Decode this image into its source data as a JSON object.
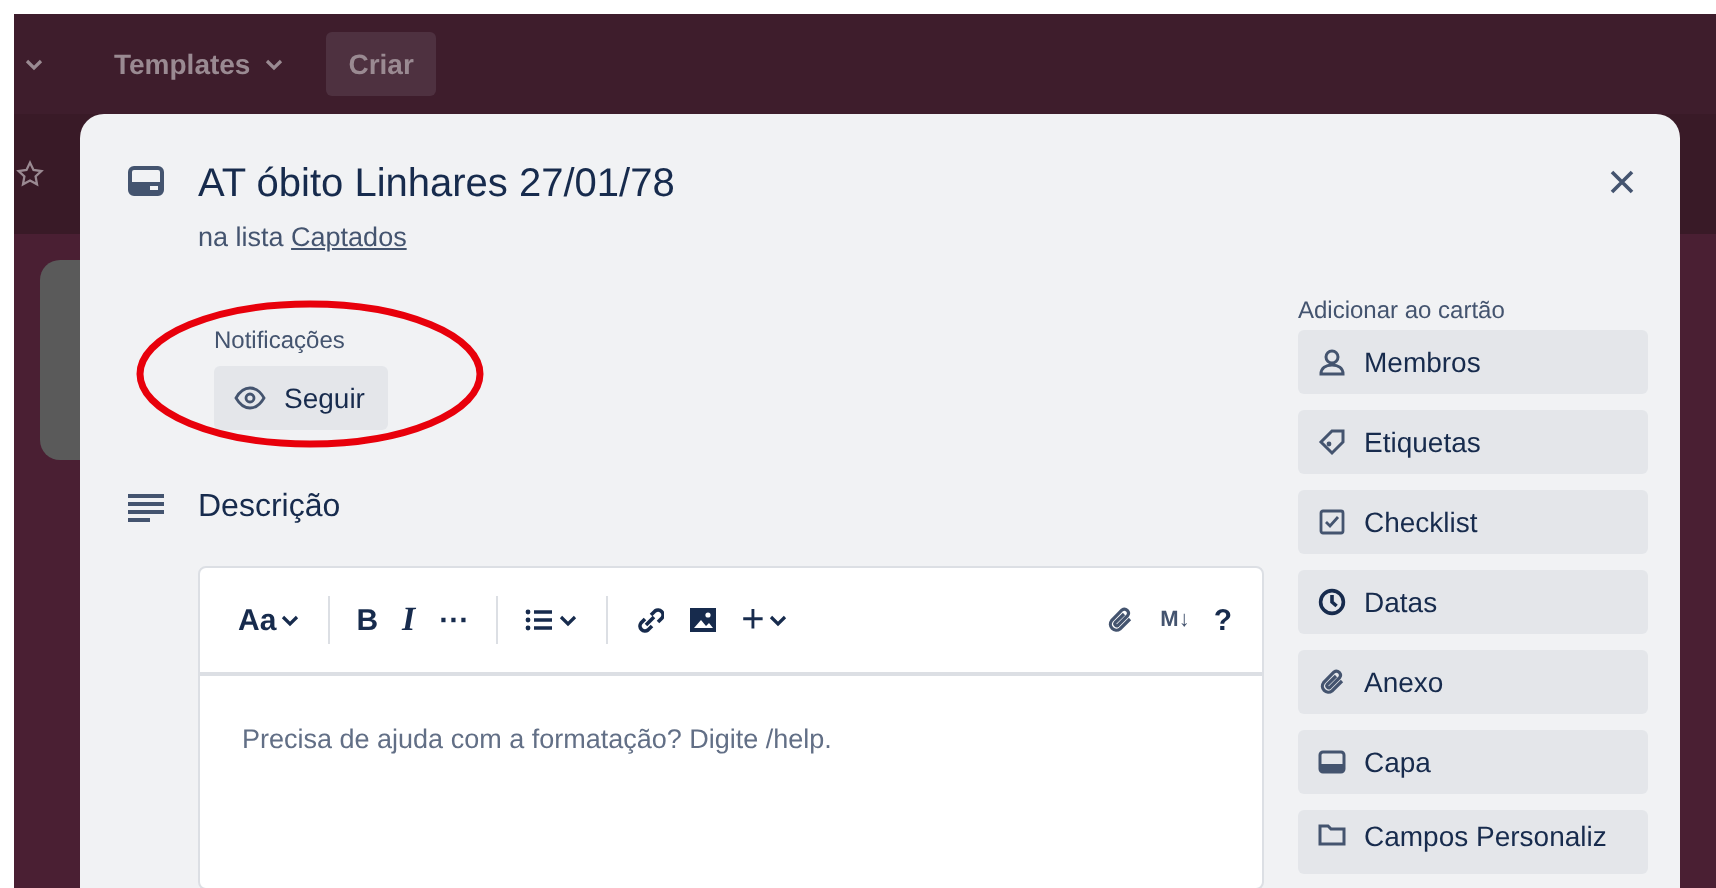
{
  "top_bar": {
    "menus": [
      {
        "label": "Templates"
      }
    ],
    "create_button": "Criar"
  },
  "card_modal": {
    "title": "AT óbito Linhares 27/01/78",
    "list_prefix": "na lista",
    "list_link": "Captados",
    "notifications": {
      "label": "Notificações",
      "button": "Seguir"
    },
    "annotation": {
      "kind": "ellipse"
    },
    "description": {
      "heading": "Descrição",
      "placeholder": "Precisa de ajuda com a formatação? Digite /help.",
      "toolbar": [
        {
          "kind": "text-style",
          "label": "Aa"
        },
        {
          "kind": "divider"
        },
        {
          "kind": "bold",
          "label": "B"
        },
        {
          "kind": "italic",
          "label": "I"
        },
        {
          "kind": "more",
          "label": "···"
        },
        {
          "kind": "divider"
        },
        {
          "kind": "list"
        },
        {
          "kind": "divider"
        },
        {
          "kind": "link"
        },
        {
          "kind": "image"
        },
        {
          "kind": "insert",
          "label": "+"
        },
        {
          "kind": "spacer"
        },
        {
          "kind": "attach"
        },
        {
          "kind": "markdown",
          "label": "M↓"
        },
        {
          "kind": "help",
          "label": "?"
        }
      ]
    },
    "add_to_card": {
      "heading": "Adicionar ao cartão",
      "buttons": [
        {
          "kind": "members",
          "label": "Membros"
        },
        {
          "kind": "labels",
          "label": "Etiquetas"
        },
        {
          "kind": "checklist",
          "label": "Checklist"
        },
        {
          "kind": "dates",
          "label": "Datas"
        },
        {
          "kind": "attachment",
          "label": "Anexo"
        },
        {
          "kind": "cover",
          "label": "Capa"
        },
        {
          "kind": "fields",
          "label": "Campos Personaliz"
        }
      ]
    }
  }
}
